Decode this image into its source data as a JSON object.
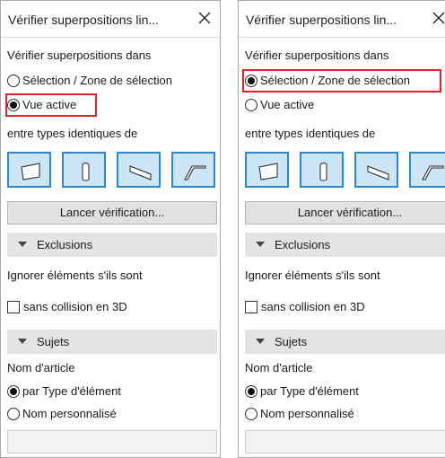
{
  "panels": [
    {
      "title": "Vérifier superpositions lin...",
      "check_in_label": "Vérifier superpositions dans",
      "scope_options": [
        {
          "label": "Sélection / Zone de sélection",
          "checked": false
        },
        {
          "label": "Vue active",
          "checked": true
        }
      ],
      "highlighted_option": "Vue active",
      "between_types_label": "entre types identiques de",
      "element_type_icons": [
        "slab-icon",
        "column-icon",
        "beam-icon",
        "roof-icon"
      ],
      "run_button_label": "Lancer vérification...",
      "exclusions": {
        "header": "Exclusions",
        "ignore_label": "Ignorer éléments s'ils sont",
        "checkbox_label": "sans collision en 3D",
        "checkbox_checked": false
      },
      "subjects": {
        "header": "Sujets",
        "item_name_label": "Nom d'article",
        "options": [
          {
            "label": "par Type d'élément",
            "checked": true
          },
          {
            "label": "Nom personnalisé",
            "checked": false
          }
        ],
        "custom_name_value": ""
      }
    },
    {
      "title": "Vérifier superpositions lin...",
      "check_in_label": "Vérifier superpositions dans",
      "scope_options": [
        {
          "label": "Sélection / Zone de sélection",
          "checked": true
        },
        {
          "label": "Vue active",
          "checked": false
        }
      ],
      "highlighted_option": "Sélection / Zone de sélection",
      "between_types_label": "entre types identiques de",
      "element_type_icons": [
        "slab-icon",
        "column-icon",
        "beam-icon",
        "roof-icon"
      ],
      "run_button_label": "Lancer vérification...",
      "exclusions": {
        "header": "Exclusions",
        "ignore_label": "Ignorer éléments s'ils sont",
        "checkbox_label": "sans collision en 3D",
        "checkbox_checked": false
      },
      "subjects": {
        "header": "Sujets",
        "item_name_label": "Nom d'article",
        "options": [
          {
            "label": "par Type d'élément",
            "checked": true
          },
          {
            "label": "Nom personnalisé",
            "checked": false
          }
        ],
        "custom_name_value": ""
      }
    }
  ],
  "colors": {
    "highlight": "#e0232a",
    "icon_selected_border": "#2b88d8",
    "icon_selected_fill": "#cde6f7",
    "section_header": "#e4e4e4"
  }
}
